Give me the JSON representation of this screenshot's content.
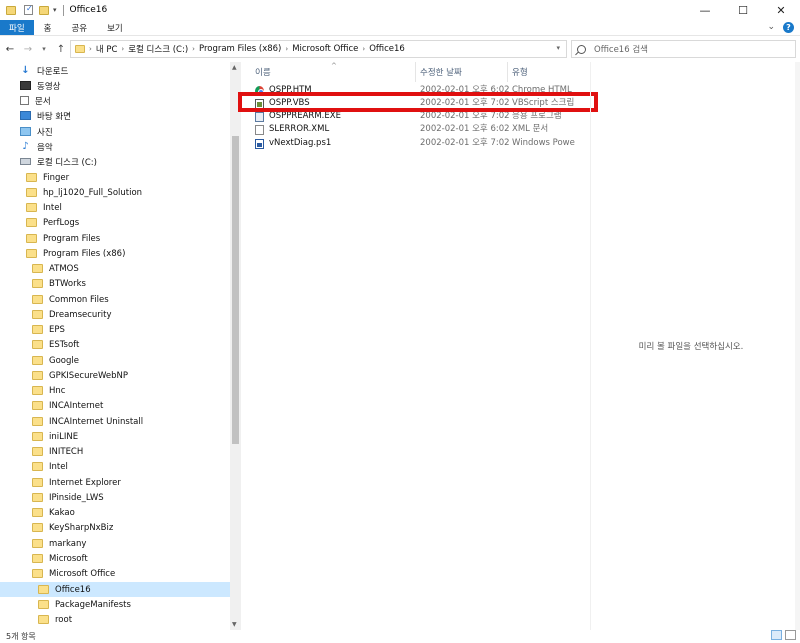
{
  "window": {
    "title": "Office16",
    "controls": [
      "—",
      "☐",
      "✕"
    ]
  },
  "ribbon": {
    "tabs": [
      "파일",
      "홈",
      "공유",
      "보기"
    ]
  },
  "address": {
    "crumbs": [
      "내 PC",
      "로컬 디스크 (C:)",
      "Program Files (x86)",
      "Microsoft Office",
      "Office16"
    ],
    "search_placeholder": "Office16 검색"
  },
  "nav_pane": {
    "items": [
      {
        "label": "다운로드",
        "icon": "download-icon"
      },
      {
        "label": "동영상",
        "icon": "video-icon"
      },
      {
        "label": "문서",
        "icon": "document-icon"
      },
      {
        "label": "바탕 화면",
        "icon": "desktop-icon"
      },
      {
        "label": "사진",
        "icon": "pictures-icon"
      },
      {
        "label": "음악",
        "icon": "music-icon"
      },
      {
        "label": "로컬 디스크 (C:)",
        "icon": "drive-icon"
      },
      {
        "label": "Finger",
        "icon": "folder-icon"
      },
      {
        "label": "hp_lj1020_Full_Solution",
        "icon": "folder-icon"
      },
      {
        "label": "Intel",
        "icon": "folder-icon"
      },
      {
        "label": "PerfLogs",
        "icon": "folder-icon"
      },
      {
        "label": "Program Files",
        "icon": "folder-icon"
      },
      {
        "label": "Program Files (x86)",
        "icon": "folder-icon"
      },
      {
        "label": "ATMOS",
        "icon": "folder-icon"
      },
      {
        "label": "BTWorks",
        "icon": "folder-icon"
      },
      {
        "label": "Common Files",
        "icon": "folder-icon"
      },
      {
        "label": "Dreamsecurity",
        "icon": "folder-icon"
      },
      {
        "label": "EPS",
        "icon": "folder-icon"
      },
      {
        "label": "ESTsoft",
        "icon": "folder-icon"
      },
      {
        "label": "Google",
        "icon": "folder-icon"
      },
      {
        "label": "GPKISecureWebNP",
        "icon": "folder-icon"
      },
      {
        "label": "Hnc",
        "icon": "folder-icon"
      },
      {
        "label": "INCAInternet",
        "icon": "folder-icon"
      },
      {
        "label": "INCAInternet Uninstall",
        "icon": "folder-icon"
      },
      {
        "label": "iniLINE",
        "icon": "folder-icon"
      },
      {
        "label": "INITECH",
        "icon": "folder-icon"
      },
      {
        "label": "Intel",
        "icon": "folder-icon"
      },
      {
        "label": "Internet Explorer",
        "icon": "folder-icon"
      },
      {
        "label": "IPinside_LWS",
        "icon": "folder-icon"
      },
      {
        "label": "Kakao",
        "icon": "folder-icon"
      },
      {
        "label": "KeySharpNxBiz",
        "icon": "folder-icon"
      },
      {
        "label": "markany",
        "icon": "folder-icon"
      },
      {
        "label": "Microsoft",
        "icon": "folder-icon"
      },
      {
        "label": "Microsoft Office",
        "icon": "folder-icon"
      },
      {
        "label": "Office16",
        "icon": "folder-icon",
        "selected": true
      },
      {
        "label": "PackageManifests",
        "icon": "folder-icon"
      },
      {
        "label": "root",
        "icon": "folder-icon"
      }
    ]
  },
  "file_list": {
    "columns": [
      "이름",
      "수정한 날짜",
      "유형"
    ],
    "files": [
      {
        "name": "OSPP.HTM",
        "date": "2002-02-01 오후 6:02",
        "type": "Chrome HTML D...",
        "icon": "chrome-icon"
      },
      {
        "name": "OSPP.VBS",
        "date": "2002-02-01 오후 7:02",
        "type": "VBScript 스크립...",
        "icon": "vbscript-icon",
        "highlighted": true
      },
      {
        "name": "OSPPREARM.EXE",
        "date": "2002-02-01 오후 7:02",
        "type": "응용 프로그램",
        "icon": "exe-icon"
      },
      {
        "name": "SLERROR.XML",
        "date": "2002-02-01 오후 6:02",
        "type": "XML 문서",
        "icon": "xml-icon"
      },
      {
        "name": "vNextDiag.ps1",
        "date": "2002-02-01 오후 7:02",
        "type": "Windows PowerS...",
        "icon": "powershell-icon"
      }
    ]
  },
  "preview": {
    "message": "미리 볼 파일을 선택하십시오."
  },
  "status": {
    "count": "5개 항목"
  },
  "colors": {
    "accent": "#1979ca",
    "highlight_box": "#e01010",
    "selected_bg": "#cce8ff"
  }
}
